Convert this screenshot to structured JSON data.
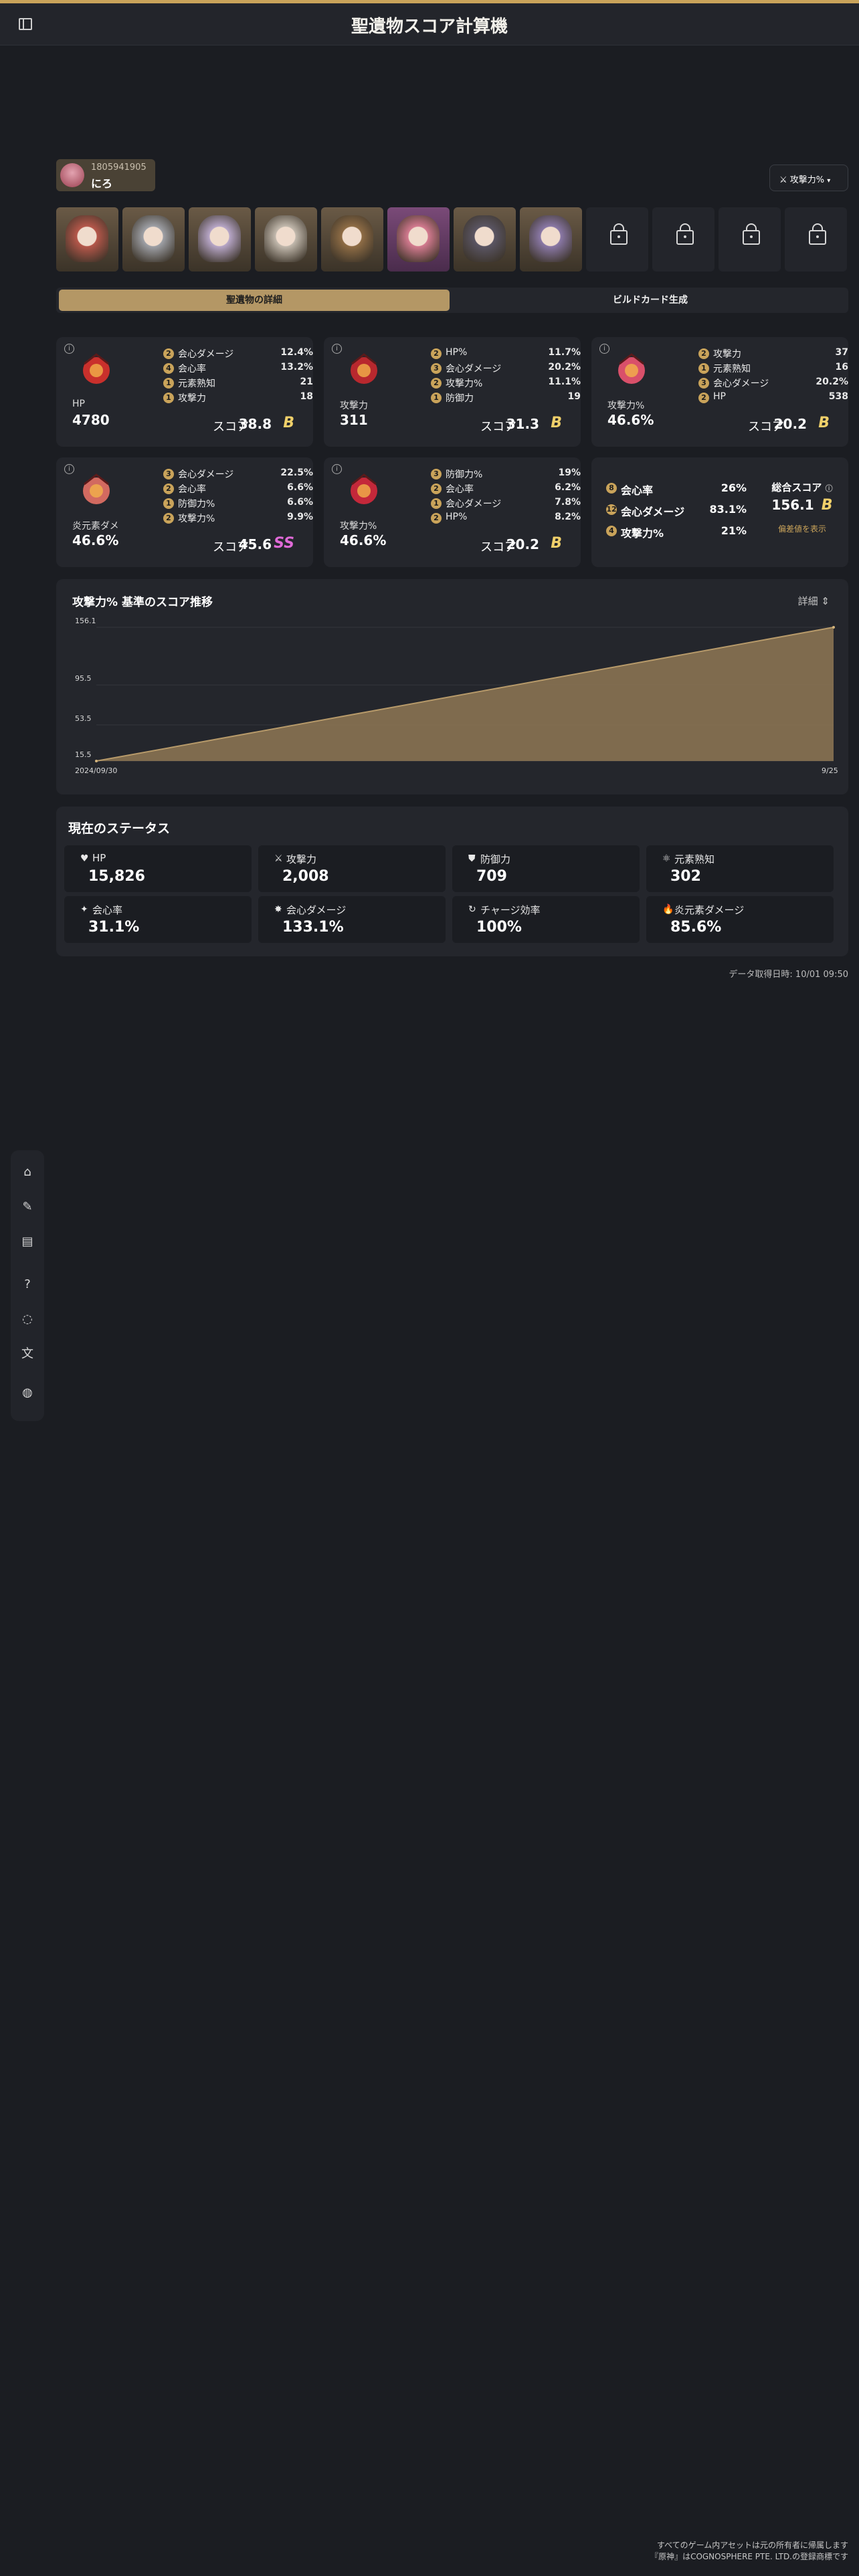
{
  "app": {
    "title": "聖遺物スコア計算機"
  },
  "profile": {
    "uid": "1805941905",
    "name": "にろ"
  },
  "stat_selector": {
    "label": "攻撃力%",
    "icon": "sword-icon"
  },
  "characters": [
    {
      "color": "#b5574a",
      "locked": false
    },
    {
      "color": "#9ea0a6",
      "locked": false
    },
    {
      "color": "#b7a6c7",
      "locked": false
    },
    {
      "color": "#c2b9ad",
      "locked": false
    },
    {
      "color": "#8e6c45",
      "locked": false
    },
    {
      "color": "#d37a8f",
      "locked": false
    },
    {
      "color": "#5a5563",
      "locked": false
    },
    {
      "color": "#8a78a6",
      "locked": false
    },
    {
      "locked": true
    },
    {
      "locked": true
    },
    {
      "locked": true
    },
    {
      "locked": true
    }
  ],
  "tabs": {
    "artifact_details": "聖遺物の詳細",
    "build_card": "ビルドカード生成"
  },
  "artifacts": [
    {
      "main_stat": "HP",
      "main_value": "4780",
      "subs": [
        {
          "rolls": "2",
          "name": "会心ダメージ",
          "value": "12.4%"
        },
        {
          "rolls": "4",
          "name": "会心率",
          "value": "13.2%"
        },
        {
          "rolls": "1",
          "name": "元素熟知",
          "value": "21"
        },
        {
          "rolls": "1",
          "name": "攻撃力",
          "value": "18"
        }
      ],
      "score_label": "スコア",
      "score": "38.8",
      "grade": "B"
    },
    {
      "main_stat": "攻撃力",
      "main_value": "311",
      "subs": [
        {
          "rolls": "2",
          "name": "HP%",
          "value": "11.7%"
        },
        {
          "rolls": "3",
          "name": "会心ダメージ",
          "value": "20.2%"
        },
        {
          "rolls": "2",
          "name": "攻撃力%",
          "value": "11.1%"
        },
        {
          "rolls": "1",
          "name": "防御力",
          "value": "19"
        }
      ],
      "score_label": "スコア",
      "score": "31.3",
      "grade": "B"
    },
    {
      "main_stat": "攻撃力%",
      "main_value": "46.6%",
      "subs": [
        {
          "rolls": "2",
          "name": "攻撃力",
          "value": "37"
        },
        {
          "rolls": "1",
          "name": "元素熟知",
          "value": "16"
        },
        {
          "rolls": "3",
          "name": "会心ダメージ",
          "value": "20.2%"
        },
        {
          "rolls": "2",
          "name": "HP",
          "value": "538"
        }
      ],
      "score_label": "スコア",
      "score": "20.2",
      "grade": "B"
    },
    {
      "main_stat": "炎元素ダメ",
      "main_value": "46.6%",
      "subs": [
        {
          "rolls": "3",
          "name": "会心ダメージ",
          "value": "22.5%"
        },
        {
          "rolls": "2",
          "name": "会心率",
          "value": "6.6%"
        },
        {
          "rolls": "1",
          "name": "防御力%",
          "value": "6.6%"
        },
        {
          "rolls": "2",
          "name": "攻撃力%",
          "value": "9.9%"
        }
      ],
      "score_label": "スコア",
      "score": "45.6",
      "grade": "SS"
    },
    {
      "main_stat": "攻撃力%",
      "main_value": "46.6%",
      "subs": [
        {
          "rolls": "3",
          "name": "防御力%",
          "value": "19%"
        },
        {
          "rolls": "2",
          "name": "会心率",
          "value": "6.2%"
        },
        {
          "rolls": "1",
          "name": "会心ダメージ",
          "value": "7.8%"
        },
        {
          "rolls": "2",
          "name": "HP%",
          "value": "8.2%"
        }
      ],
      "score_label": "スコア",
      "score": "20.2",
      "grade": "B"
    }
  ],
  "summary": {
    "rows": [
      {
        "rolls": "8",
        "name": "会心率",
        "value": "26%"
      },
      {
        "rolls": "12",
        "name": "会心ダメージ",
        "value": "83.1%"
      },
      {
        "rolls": "4",
        "name": "攻撃力%",
        "value": "21%"
      }
    ],
    "total_label": "総合スコア",
    "total_score": "156.1",
    "total_grade": "B",
    "detail_link": "偏差値を表示"
  },
  "chart_data": {
    "type": "area",
    "title": "攻撃力% 基準のスコア推移",
    "detail_label": "詳細",
    "x_labels": [
      "2024/09/30",
      "9/25"
    ],
    "y_ticks": [
      "156.1",
      "95.5",
      "53.5",
      "15.5"
    ],
    "values": [
      15.5,
      156.1
    ],
    "ylim": [
      15.5,
      156.1
    ],
    "fill_color": "#8a7352"
  },
  "status": {
    "title": "現在のステータス",
    "items": [
      {
        "icon": "heart-icon",
        "label": "HP",
        "value": "15,826"
      },
      {
        "icon": "sword-icon",
        "label": "攻撃力",
        "value": "2,008"
      },
      {
        "icon": "shield-icon",
        "label": "防御力",
        "value": "709"
      },
      {
        "icon": "elemental-mastery-icon",
        "label": "元素熟知",
        "value": "302"
      },
      {
        "icon": "crit-rate-icon",
        "label": "会心率",
        "value": "31.1%"
      },
      {
        "icon": "crit-damage-icon",
        "label": "会心ダメージ",
        "value": "133.1%"
      },
      {
        "icon": "energy-recharge-icon",
        "label": "チャージ効率",
        "value": "100%"
      },
      {
        "icon": "pyro-icon",
        "label": "炎元素ダメージ",
        "value": "85.6%"
      }
    ]
  },
  "fetch_time": "データ取得日時: 10/01 09:50",
  "nav": [
    "home-icon",
    "edit-icon",
    "book-icon",
    "help-chat-icon",
    "chat-icon",
    "translate-icon",
    "globe-icon"
  ],
  "footer": {
    "line1": "すべてのゲーム内アセットは元の所有者に帰属します",
    "line2": "『原神』はCOGNOSPHERE PTE. LTD.の登録商標です"
  }
}
